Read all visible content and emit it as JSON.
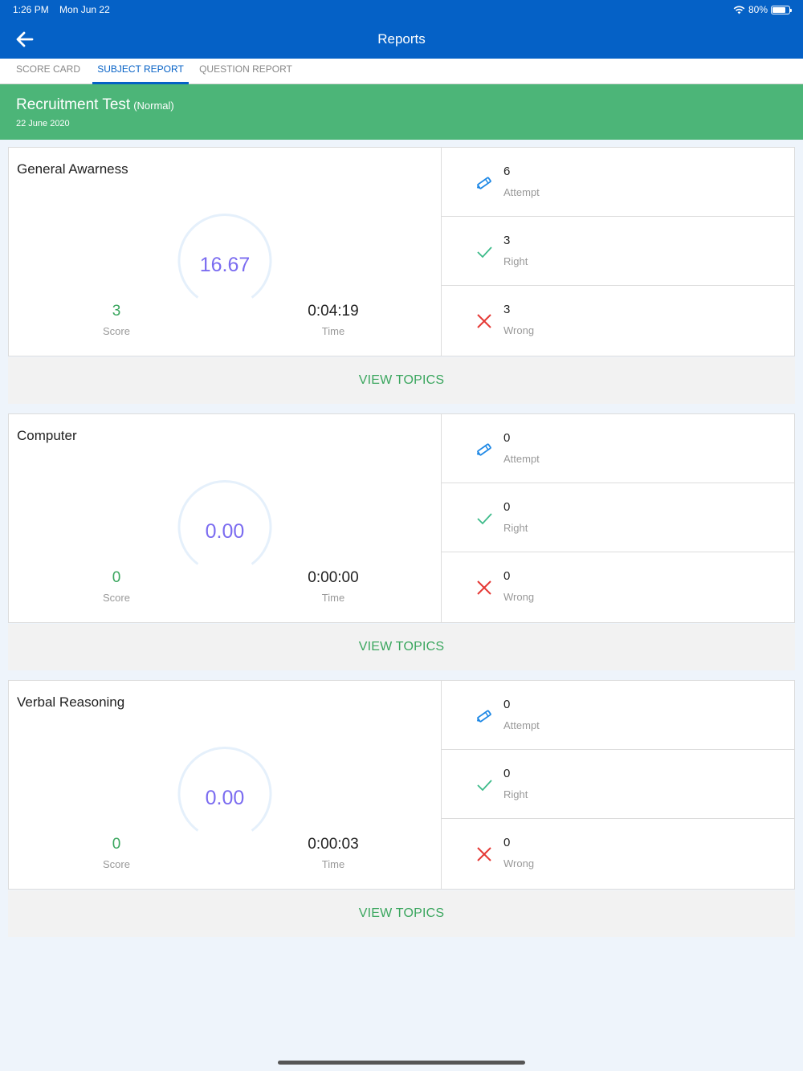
{
  "status": {
    "time": "1:26 PM",
    "date": "Mon Jun 22",
    "battery": "80%",
    "battery_level": 0.8
  },
  "header": {
    "title": "Reports"
  },
  "tabs": [
    {
      "label": "SCORE CARD",
      "active": false
    },
    {
      "label": "SUBJECT REPORT",
      "active": true
    },
    {
      "label": "QUESTION REPORT",
      "active": false
    }
  ],
  "test": {
    "name": "Recruitment Test",
    "mode": "(Normal)",
    "date": "22 June 2020"
  },
  "labels": {
    "score": "Score",
    "time": "Time",
    "attempt": "Attempt",
    "right": "Right",
    "wrong": "Wrong",
    "view_topics": "VIEW TOPICS"
  },
  "subjects": [
    {
      "name": "General Awarness",
      "percentage": "16.67",
      "score": "3",
      "time": "0:04:19",
      "attempt": "6",
      "right": "3",
      "wrong": "3"
    },
    {
      "name": "Computer",
      "percentage": "0.00",
      "score": "0",
      "time": "0:00:00",
      "attempt": "0",
      "right": "0",
      "wrong": "0"
    },
    {
      "name": "Verbal Reasoning",
      "percentage": "0.00",
      "score": "0",
      "time": "0:00:03",
      "attempt": "0",
      "right": "0",
      "wrong": "0"
    }
  ],
  "colors": {
    "primary": "#0561c6",
    "header_green": "#4cb578",
    "score_green": "#3aa65e",
    "gauge_purple": "#7b6cf0",
    "attempt_icon": "#1e88e5",
    "right_icon": "#3dbb8a",
    "wrong_icon": "#e53935"
  },
  "icons": {
    "back": "arrow-left-icon",
    "attempt": "pencil-icon",
    "right": "check-icon",
    "wrong": "cross-icon",
    "wifi": "wifi-icon",
    "battery": "battery-icon"
  }
}
